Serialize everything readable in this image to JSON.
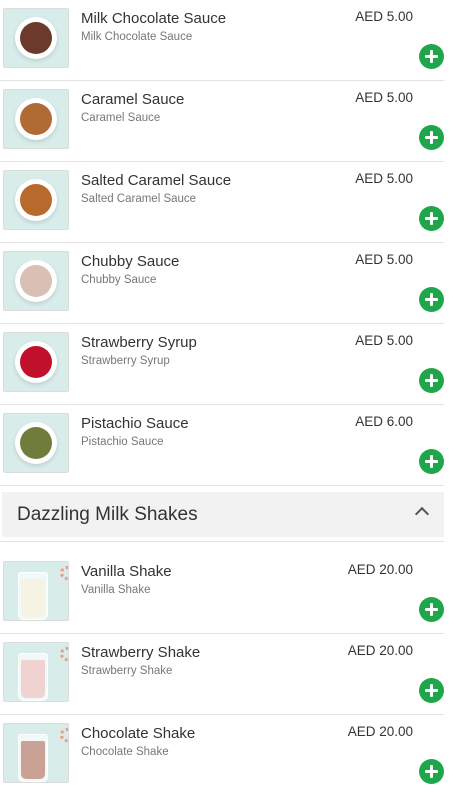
{
  "sauces": [
    {
      "name": "Milk Chocolate Sauce",
      "description": "Milk Chocolate Sauce",
      "price": "AED 5.00",
      "sauce_color": "#6b3a2c"
    },
    {
      "name": "Caramel Sauce",
      "description": "Caramel Sauce",
      "price": "AED 5.00",
      "sauce_color": "#b06a34"
    },
    {
      "name": "Salted Caramel Sauce",
      "description": "Salted Caramel Sauce",
      "price": "AED 5.00",
      "sauce_color": "#b8692c"
    },
    {
      "name": "Chubby Sauce",
      "description": "Chubby Sauce",
      "price": "AED 5.00",
      "sauce_color": "#d9bfb4"
    },
    {
      "name": "Strawberry Syrup",
      "description": "Strawberry Syrup",
      "price": "AED 5.00",
      "sauce_color": "#c0102a"
    },
    {
      "name": "Pistachio Sauce",
      "description": "Pistachio Sauce",
      "price": "AED 6.00",
      "sauce_color": "#6e7d3c"
    }
  ],
  "section": {
    "title": "Dazzling Milk Shakes"
  },
  "shakes": [
    {
      "name": "Vanilla Shake",
      "description": "Vanilla Shake",
      "price": "AED 20.00",
      "drink_color": "#f6f2e4"
    },
    {
      "name": "Strawberry Shake",
      "description": "Strawberry Shake",
      "price": "AED 20.00",
      "drink_color": "#f0d2d0"
    },
    {
      "name": "Chocolate Shake",
      "description": "Chocolate Shake",
      "price": "AED 20.00",
      "drink_color": "#c9a195"
    }
  ],
  "colors": {
    "add_button": "#1fa64a",
    "thumb_bg": "#d8ecea",
    "section_bg": "#f2f2f2"
  },
  "icons": {
    "add": "plus-circle-icon",
    "collapse": "chevron-up-icon"
  }
}
